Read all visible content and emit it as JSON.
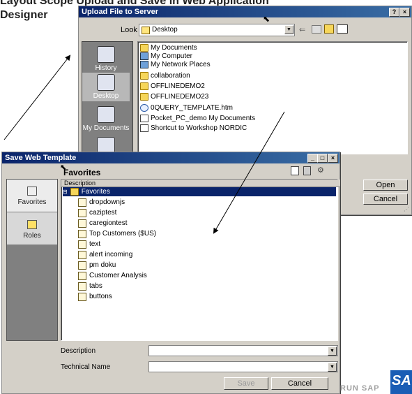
{
  "slide": {
    "title_line1": "Layout Scope Upload and Save in Web Application",
    "title_line2": "Designer",
    "footer_text": "RUN SAP",
    "logo_text": "SA"
  },
  "upload_dialog": {
    "title": "Upload File to Server",
    "help_button": "?",
    "close_button": "×",
    "look_in_label": "Look in:",
    "look_in_value": "Desktop",
    "places": [
      {
        "label": "History",
        "icon": "history-icon"
      },
      {
        "label": "Desktop",
        "icon": "desktop-icon"
      },
      {
        "label": "My Documents",
        "icon": "my-documents-icon"
      },
      {
        "label": "",
        "icon": "my-computer-icon"
      }
    ],
    "files": [
      {
        "name": "My Documents",
        "icon": "folder-icon"
      },
      {
        "name": "My Computer",
        "icon": "computer-icon"
      },
      {
        "name": "My Network Places",
        "icon": "network-icon"
      },
      {
        "name": "collaboration",
        "icon": "folder-icon"
      },
      {
        "name": "OFFLINEDEMO2",
        "icon": "folder-icon"
      },
      {
        "name": "OFFLINEDEMO23",
        "icon": "folder-icon"
      },
      {
        "name": "0QUERY_TEMPLATE.htm",
        "icon": "html-file-icon"
      },
      {
        "name": "Pocket_PC_demo My Documents",
        "icon": "shortcut-icon"
      },
      {
        "name": "Shortcut to Workshop NORDIC",
        "icon": "shortcut-icon"
      }
    ],
    "open_button": "Open",
    "cancel_button": "Cancel"
  },
  "save_dialog": {
    "title": "Save Web Template",
    "minimize_button": "_",
    "maximize_button": "□",
    "close_button": "×",
    "header_title": "Favorites",
    "sidebar": [
      {
        "label": "Favorites",
        "icon": "favorites-icon"
      },
      {
        "label": "Roles",
        "icon": "roles-icon"
      }
    ],
    "column_header": "Description",
    "root_item": "Favorites",
    "items": [
      "dropdownjs",
      "caziptest",
      "caregiontest",
      "Top Customers ($US)",
      "text",
      "alert incoming",
      "pm doku",
      "Customer Analysis",
      "tabs",
      "buttons"
    ],
    "description_label": "Description",
    "technical_name_label": "Technical Name",
    "save_button": "Save",
    "cancel_button": "Cancel"
  },
  "colors": {
    "titlebar": "#0a246a",
    "sidebar_places": "#808080",
    "selection": "#0a246a"
  }
}
